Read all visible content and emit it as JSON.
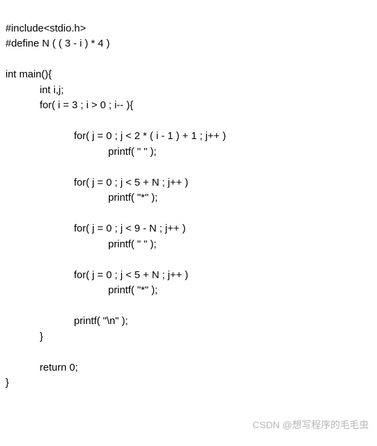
{
  "code": {
    "line1": "#include<stdio.h>",
    "line2": "#define N ( ( 3 - i ) * 4 )",
    "line3": "",
    "line4": "int main(){",
    "line5": "            int i,j;",
    "line6": "            for( i = 3 ; i > 0 ; i-- ){",
    "line7": "",
    "line8": "                        for( j = 0 ; j < 2 * ( i - 1 ) + 1 ; j++ )",
    "line9": "                                    printf( \" \" );",
    "line10": "",
    "line11": "                        for( j = 0 ; j < 5 + N ; j++ )",
    "line12": "                                    printf( \"*\" );",
    "line13": "",
    "line14": "                        for( j = 0 ; j < 9 - N ; j++ )",
    "line15": "                                    printf( \" \" );",
    "line16": "",
    "line17": "                        for( j = 0 ; j < 5 + N ; j++ )",
    "line18": "                                    printf( \"*\" );",
    "line19": "",
    "line20": "                        printf( \"\\n\" );",
    "line21": "            }",
    "line22": "",
    "line23": "            return 0;",
    "line24": "}"
  },
  "watermark": "CSDN @想写程序的毛毛虫"
}
